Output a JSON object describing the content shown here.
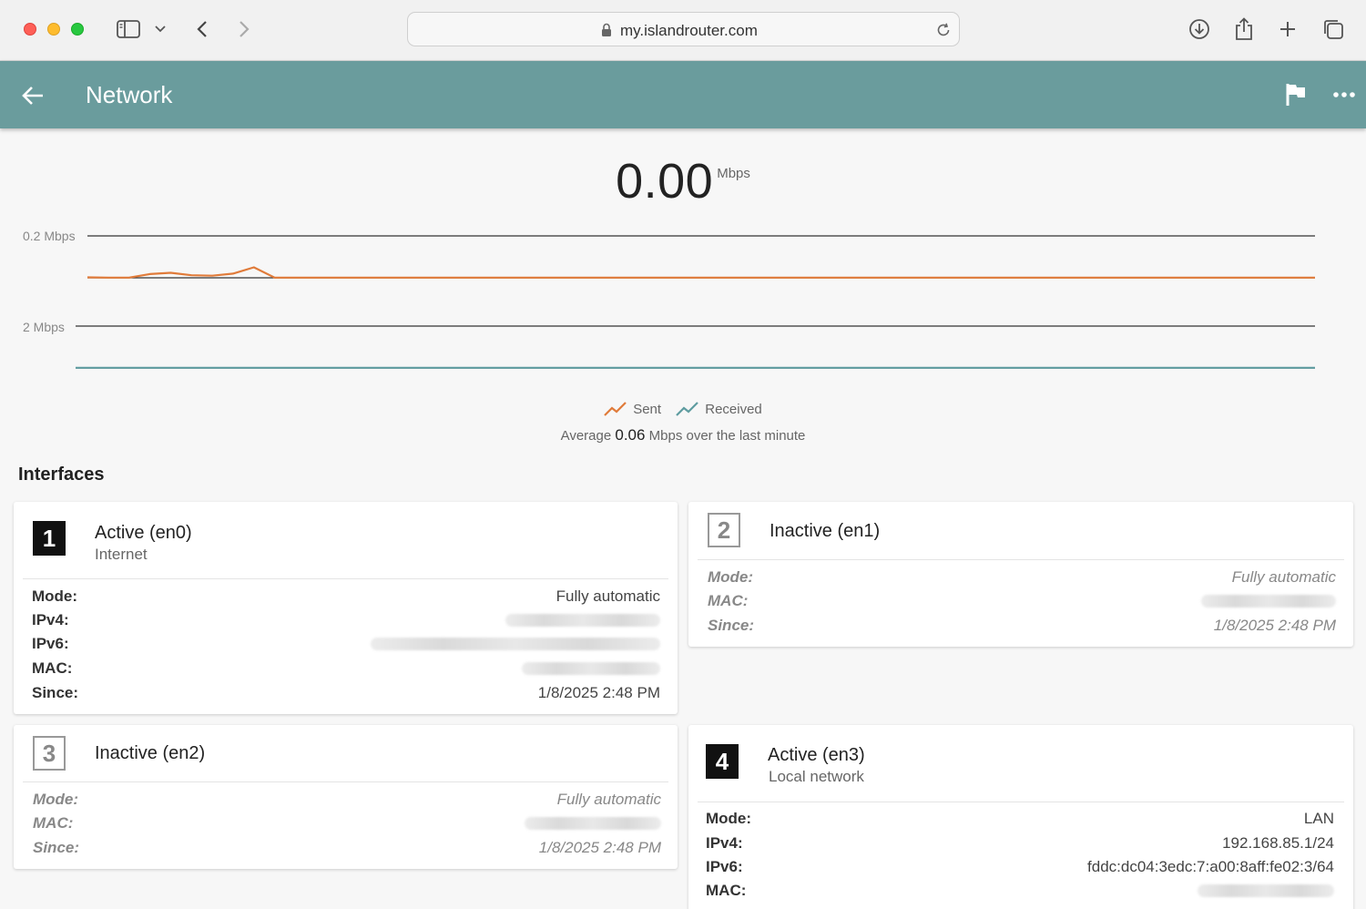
{
  "browser": {
    "url": "my.islandrouter.com",
    "icons": {
      "sidebar": "sidebar-icon",
      "chevron": "chevron-down-icon",
      "back": "chevron-left-icon",
      "forward": "chevron-right-icon",
      "lock": "lock-icon",
      "reload": "reload-icon",
      "download": "download-icon",
      "share": "share-icon",
      "new_tab": "plus-icon",
      "tabs": "tabs-overview-icon"
    }
  },
  "header": {
    "title": "Network",
    "color": "#6a9c9d",
    "icons": {
      "back": "arrow-left-icon",
      "flag": "flag-icon",
      "more": "more-horizontal-icon"
    }
  },
  "throughput": {
    "value": "0.00",
    "unit": "Mbps",
    "average_prefix": "Average",
    "average_value": "0.06",
    "average_suffix": "Mbps over the last minute"
  },
  "chart_data": {
    "type": "line",
    "series": [
      {
        "name": "Sent",
        "color": "#e07b3a",
        "scale_label": "0.2 Mbps",
        "ylim": [
          0,
          0.2
        ],
        "values": [
          0.002,
          0.001,
          0.001,
          0.018,
          0.024,
          0.012,
          0.01,
          0.02,
          0.05,
          0.001,
          0.001,
          0.001,
          0.001,
          0.001,
          0.001,
          0.001,
          0.001,
          0.001,
          0.001,
          0.001,
          0.001,
          0.001,
          0.001,
          0.001,
          0.001,
          0.001,
          0.001,
          0.001,
          0.001,
          0.001,
          0.001,
          0.001,
          0.001,
          0.001,
          0.001,
          0.001,
          0.001,
          0.001,
          0.001,
          0.001,
          0.001,
          0.001,
          0.001,
          0.001,
          0.001,
          0.001,
          0.001,
          0.001,
          0.001,
          0.001,
          0.001,
          0.001,
          0.001,
          0.001,
          0.001,
          0.001,
          0.001,
          0.001,
          0.001,
          0.001
        ]
      },
      {
        "name": "Received",
        "color": "#5e9ca0",
        "scale_label": "2 Mbps",
        "ylim": [
          0,
          2
        ],
        "values": [
          0.01,
          0.01,
          0.01,
          0.01,
          0.01,
          0.01,
          0.01,
          0.01,
          0.01,
          0.01,
          0.01,
          0.01,
          0.01,
          0.01,
          0.01,
          0.01,
          0.01,
          0.01,
          0.01,
          0.01,
          0.01,
          0.01,
          0.01,
          0.01,
          0.01,
          0.01,
          0.01,
          0.01,
          0.01,
          0.01,
          0.01,
          0.01,
          0.01,
          0.01,
          0.01,
          0.01,
          0.01,
          0.01,
          0.01,
          0.01,
          0.01,
          0.01,
          0.01,
          0.01,
          0.01,
          0.01,
          0.01,
          0.01,
          0.01,
          0.01,
          0.01,
          0.01,
          0.01,
          0.01,
          0.01,
          0.01,
          0.01,
          0.01,
          0.01,
          0.01
        ]
      }
    ],
    "grid": false,
    "legend": "bottom-center"
  },
  "interfaces": {
    "title": "Interfaces",
    "cards": [
      {
        "number": "1",
        "status": "Active (en0)",
        "subtitle": "Internet",
        "rows": [
          {
            "key": "Mode:",
            "value": "Fully automatic"
          },
          {
            "key": "IPv4:",
            "value": ""
          },
          {
            "key": "IPv6:",
            "value": ""
          },
          {
            "key": "MAC:",
            "value": ""
          },
          {
            "key": "Since:",
            "value": "1/8/2025 2:48 PM"
          }
        ]
      },
      {
        "number": "2",
        "status": "Inactive (en1)",
        "rows": [
          {
            "key": "Mode:",
            "value": "Fully automatic"
          },
          {
            "key": "MAC:",
            "value": ""
          },
          {
            "key": "Since:",
            "value": "1/8/2025 2:48 PM"
          }
        ]
      },
      {
        "number": "3",
        "status": "Inactive (en2)",
        "rows": [
          {
            "key": "Mode:",
            "value": "Fully automatic"
          },
          {
            "key": "MAC:",
            "value": ""
          },
          {
            "key": "Since:",
            "value": "1/8/2025 2:48 PM"
          }
        ]
      },
      {
        "number": "4",
        "status": "Active (en3)",
        "subtitle": "Local network",
        "rows": [
          {
            "key": "Mode:",
            "value": "LAN"
          },
          {
            "key": "IPv4:",
            "value": "192.168.85.1/24"
          },
          {
            "key": "IPv6:",
            "value": "fddc:dc04:3edc:7:a00:8aff:fe02:3/64"
          },
          {
            "key": "MAC:",
            "value": ""
          }
        ]
      }
    ]
  }
}
